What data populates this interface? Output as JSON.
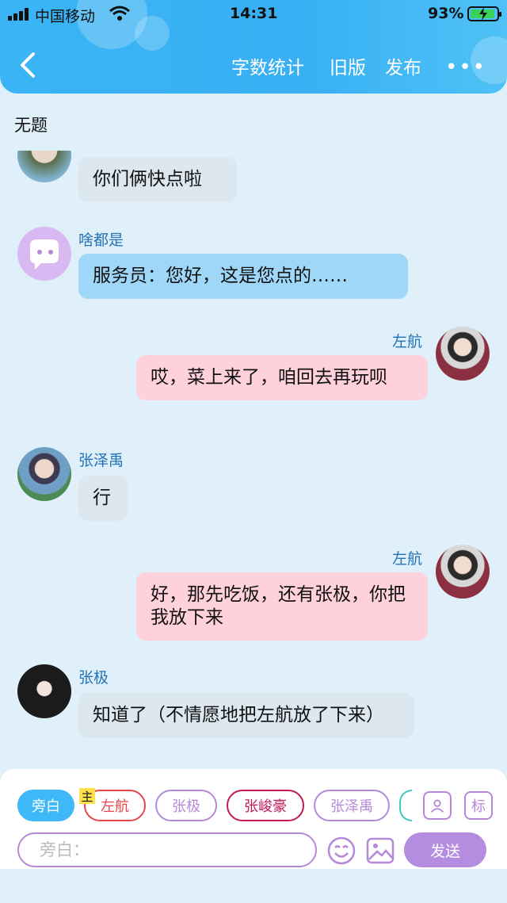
{
  "status_bar": {
    "carrier": "中国移动",
    "time": "14:31",
    "battery": "93%"
  },
  "nav": {
    "word_count": "字数统计",
    "old_version": "旧版",
    "publish": "发布",
    "more": "•••"
  },
  "document": {
    "title": "无题"
  },
  "messages": [
    {
      "side": "left",
      "name": "",
      "text": "你们俩快点啦",
      "color": "gray"
    },
    {
      "side": "left",
      "name": "啥都是",
      "text": "服务员：您好，这是您点的……",
      "color": "blue"
    },
    {
      "side": "right",
      "name": "左航",
      "text": "哎，菜上来了，咱回去再玩呗",
      "color": "pink"
    },
    {
      "side": "left",
      "name": "张泽禹",
      "text": "行",
      "color": "gray"
    },
    {
      "side": "right",
      "name": "左航",
      "text": "好，那先吃饭，还有张极，你把我放下来",
      "color": "pink"
    },
    {
      "side": "left",
      "name": "张极",
      "text": "知道了（不情愿地把左航放了下来）",
      "color": "gray"
    }
  ],
  "roles": [
    {
      "label": "旁白",
      "color": "#3eb8f6"
    },
    {
      "label": "左航",
      "color": "#e8474a"
    },
    {
      "label": "张极",
      "color": "#b48ad8"
    },
    {
      "label": "张峻豪",
      "color": "#c2185b"
    },
    {
      "label": "张泽禹",
      "color": "#b48ad8"
    }
  ],
  "main_badge": "主",
  "tag_button": "标",
  "input": {
    "placeholder": "旁白："
  },
  "send_label": "发送",
  "colors": {
    "header": "#3bb4f5",
    "accent_purple": "#b58de0",
    "name_blue": "#2473b6"
  }
}
